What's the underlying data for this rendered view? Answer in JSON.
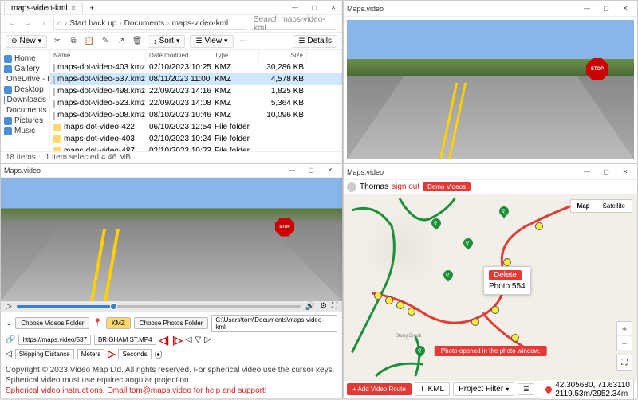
{
  "explorer": {
    "tab": "maps-video-kml",
    "breadcrumb": [
      "Start back up",
      "Documents",
      "maps-video-kml"
    ],
    "search_ph": "Search maps-video-kml",
    "new_btn": "New",
    "sort_btn": "Sort",
    "view_btn": "View",
    "details_btn": "Details",
    "cols": {
      "name": "Name",
      "date": "Date modified",
      "type": "Type",
      "size": "Size"
    },
    "sidebar": [
      {
        "label": "Home",
        "color": "#4a90d9"
      },
      {
        "label": "Gallery",
        "color": "#4a90d9"
      },
      {
        "label": "OneDrive - Pers",
        "color": "#0078d4"
      },
      {
        "label": "Desktop",
        "color": "#4a90d9"
      },
      {
        "label": "Downloads",
        "color": "#4a90d9"
      },
      {
        "label": "Documents",
        "color": "#4a90d9"
      },
      {
        "label": "Pictures",
        "color": "#4a90d9"
      },
      {
        "label": "Music",
        "color": "#4a90d9"
      }
    ],
    "rows": [
      {
        "name": "maps-dot-video-403.kmz",
        "date": "02/10/2023 10:25",
        "type": "KMZ",
        "size": "30,286 KB",
        "kind": "kmz",
        "sel": false
      },
      {
        "name": "maps-dot-video-537.kmz",
        "date": "08/11/2023 11:00",
        "type": "KMZ",
        "size": "4,578 KB",
        "kind": "kmz",
        "sel": true
      },
      {
        "name": "maps-dot-video-498.kmz",
        "date": "22/09/2023 14:16",
        "type": "KMZ",
        "size": "1,825 KB",
        "kind": "kmz",
        "sel": false
      },
      {
        "name": "maps-dot-video-523.kmz",
        "date": "22/09/2023 14:08",
        "type": "KMZ",
        "size": "5,364 KB",
        "kind": "kmz",
        "sel": false
      },
      {
        "name": "maps-dot-video-508.kmz",
        "date": "08/10/2023 10:46",
        "type": "KMZ",
        "size": "10,096 KB",
        "kind": "kmz",
        "sel": false
      },
      {
        "name": "maps-dot-video-422",
        "date": "06/10/2023 12:54",
        "type": "File folder",
        "size": "",
        "kind": "fld",
        "sel": false
      },
      {
        "name": "maps-dot-video-403",
        "date": "02/10/2023 10:24",
        "type": "File folder",
        "size": "",
        "kind": "fld",
        "sel": false
      },
      {
        "name": "maps-dot-video-487",
        "date": "02/10/2023 10:23",
        "type": "File folder",
        "size": "",
        "kind": "fld",
        "sel": false
      }
    ],
    "status_items": "18 items",
    "status_sel": "1 item selected  4.46 MB"
  },
  "viewer": {
    "title": "Maps.video",
    "stop": "STOP"
  },
  "player": {
    "title": "Maps.video",
    "stop": "STOP",
    "choose_videos": "Choose Videos Folder",
    "kmz": "KMZ",
    "choose_photos": "Choose Photos Folder",
    "folder_path": "C:\\Users\\tom\\Documents\\maps-video-kml",
    "url": "https://maps.video/537",
    "filename": "BRIGHAM ST.MP4",
    "skip": "Skipping Distance",
    "meters": "Meters",
    "seconds": "Seconds",
    "copyright": "Copyright © 2023 Video Map Ltd. All rights reserved. For spherical video use the cursor keys. Spherical video must use equirectangular projection.",
    "support": "Spherical video instructions. Email tom@maps.video for help and support!"
  },
  "map": {
    "title": "Maps.video",
    "user": "Thomas",
    "signout": "sign out",
    "demo": "Demo Videos",
    "map_btn": "Map",
    "sat_btn": "Satellite",
    "popup_delete": "Delete",
    "popup_label": "Photo 554",
    "toast": "Photo opened in the photo window.",
    "add_route": "+ Add Video Route",
    "kml": "KML",
    "filter": "Project Filter",
    "coords_line1": "42.305680, 71.63110",
    "coords_line2": "2119.53m/2952.34m",
    "place_labels": [
      "Stony Brook"
    ]
  }
}
